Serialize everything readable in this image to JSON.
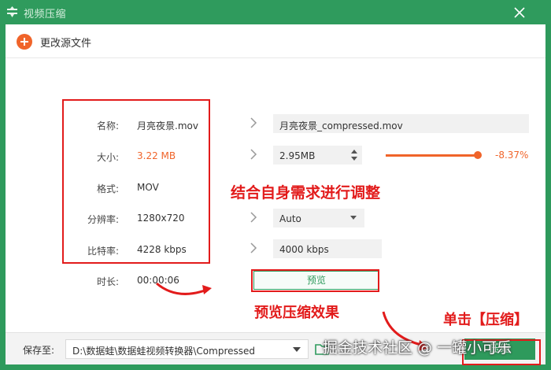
{
  "window": {
    "title": "视频压缩"
  },
  "toolbar": {
    "change_source_label": "更改源文件"
  },
  "source": {
    "name_label": "名称:",
    "name_value": "月亮夜景.mov",
    "size_label": "大小:",
    "size_value": "3.22 MB",
    "format_label": "格式:",
    "format_value": "MOV",
    "resolution_label": "分辨率:",
    "resolution_value": "1280x720",
    "bitrate_label": "比特率:",
    "bitrate_value": "4228 kbps",
    "duration_label": "时长:",
    "duration_value": "00:00:06"
  },
  "output": {
    "name": "月亮夜景_compressed.mov",
    "size": "2.95MB",
    "size_change": "-8.37%",
    "size_ratio": 0.9163,
    "resolution": "Auto",
    "bitrate": "4000 kbps"
  },
  "preview_label": "预览",
  "save": {
    "label": "保存至:",
    "path": "D:\\数据蛙\\数据蛙视频转换器\\Compressed"
  },
  "compress_label": "压缩",
  "annotations": {
    "adjust": "结合自身需求进行调整",
    "preview_effect": "预览压缩效果",
    "click_compress": "单击【压缩】"
  },
  "watermark": "掘金技术社区 @ 一罐小可乐",
  "colors": {
    "brand_green": "#2e9a5c",
    "accent_orange": "#f0642a",
    "annotation_red": "#e21b1b"
  },
  "icons": [
    "app-icon",
    "add-icon",
    "close-icon",
    "chevron-right-icon",
    "folder-icon",
    "dropdown-arrow-icon"
  ]
}
